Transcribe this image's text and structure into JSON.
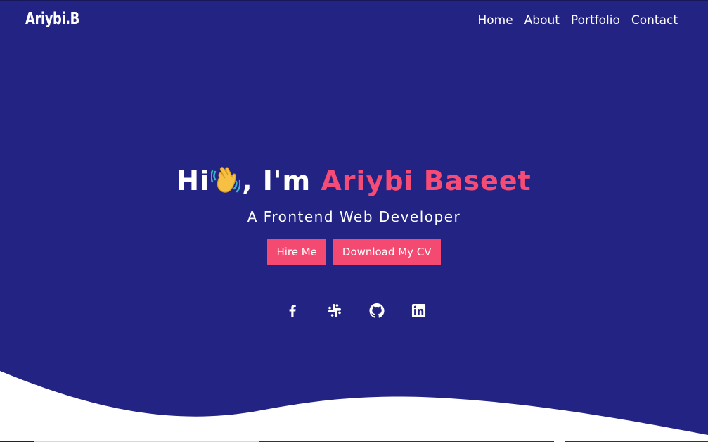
{
  "header": {
    "logo": "Ariybi.B",
    "nav": [
      "Home",
      "About",
      "Portfolio",
      "Contact"
    ]
  },
  "hero": {
    "greeting_prefix": "Hi",
    "greeting_suffix": ", I'm ",
    "name": "Ariybi Baseet",
    "subtitle": "A Frontend Web Developer",
    "buttons": {
      "hire": "Hire Me",
      "cv": "Download My CV"
    },
    "social_icons": [
      "facebook-icon",
      "slack-icon",
      "github-icon",
      "linkedin-icon"
    ]
  },
  "colors": {
    "hero_background": "#232383",
    "accent": "#f54b74",
    "text": "#ffffff",
    "page_background": "#ffffff"
  }
}
